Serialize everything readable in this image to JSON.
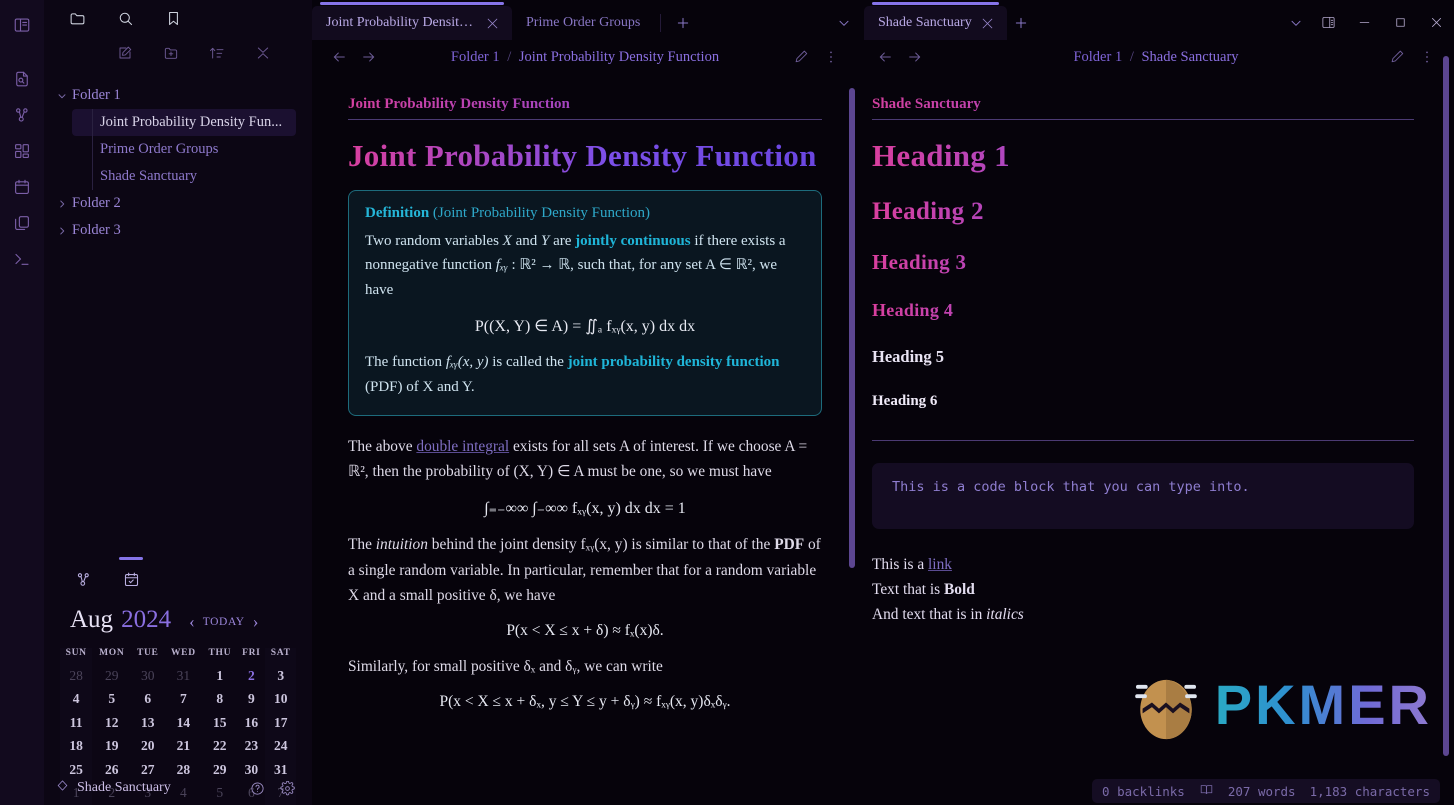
{
  "rail": {
    "icons": [
      {
        "name": "sidebar-toggle-icon",
        "label": "Toggle sidebar"
      },
      {
        "name": "file-search-icon",
        "label": "Search in file"
      },
      {
        "name": "graph-view-icon",
        "label": "Graph view"
      },
      {
        "name": "bases-grid-icon",
        "label": "Bases"
      },
      {
        "name": "calendar-icon",
        "label": "Calendar"
      },
      {
        "name": "templates-copy-icon",
        "label": "Templates"
      },
      {
        "name": "terminal-icon",
        "label": "Terminal"
      }
    ]
  },
  "sidebar": {
    "tabs": [
      {
        "name": "files-tab",
        "label": "Files"
      },
      {
        "name": "search-tab",
        "label": "Search"
      },
      {
        "name": "bookmarks-tab",
        "label": "Bookmarks"
      }
    ],
    "toolbar": [
      {
        "name": "new-note-button",
        "label": "New note"
      },
      {
        "name": "new-folder-button",
        "label": "New folder"
      },
      {
        "name": "sort-order-button",
        "label": "Change sort order"
      },
      {
        "name": "collapse-all-button",
        "label": "Collapse all"
      }
    ],
    "tree": [
      {
        "type": "folder",
        "label": "Folder 1",
        "expanded": true
      },
      {
        "type": "file",
        "label": "Joint Probability Density Fun...",
        "selected": true
      },
      {
        "type": "file",
        "label": "Prime Order Groups",
        "selected": false
      },
      {
        "type": "file",
        "label": "Shade Sanctuary",
        "selected": false
      },
      {
        "type": "folder",
        "label": "Folder 2",
        "expanded": false
      },
      {
        "type": "folder",
        "label": "Folder 3",
        "expanded": false
      }
    ],
    "calendar": {
      "tabs": [
        {
          "name": "outgoing-links-tab",
          "label": "Outgoing links"
        },
        {
          "name": "calendar-tab",
          "label": "Calendar"
        }
      ],
      "month": "Aug",
      "year": "2024",
      "today_label": "TODAY",
      "prev_label": "‹",
      "next_label": "›",
      "weekdays": [
        "SUN",
        "MON",
        "TUE",
        "WED",
        "THU",
        "FRI",
        "SAT"
      ],
      "weeks": [
        [
          {
            "d": "28",
            "dim": true
          },
          {
            "d": "29",
            "dim": true
          },
          {
            "d": "30",
            "dim": true
          },
          {
            "d": "31",
            "dim": true
          },
          {
            "d": "1"
          },
          {
            "d": "2",
            "hl": true
          },
          {
            "d": "3"
          }
        ],
        [
          {
            "d": "4"
          },
          {
            "d": "5"
          },
          {
            "d": "6"
          },
          {
            "d": "7"
          },
          {
            "d": "8"
          },
          {
            "d": "9"
          },
          {
            "d": "10"
          }
        ],
        [
          {
            "d": "11"
          },
          {
            "d": "12"
          },
          {
            "d": "13"
          },
          {
            "d": "14"
          },
          {
            "d": "15"
          },
          {
            "d": "16"
          },
          {
            "d": "17"
          }
        ],
        [
          {
            "d": "18"
          },
          {
            "d": "19"
          },
          {
            "d": "20"
          },
          {
            "d": "21"
          },
          {
            "d": "22"
          },
          {
            "d": "23"
          },
          {
            "d": "24"
          }
        ],
        [
          {
            "d": "25"
          },
          {
            "d": "26"
          },
          {
            "d": "27"
          },
          {
            "d": "28"
          },
          {
            "d": "29"
          },
          {
            "d": "30"
          },
          {
            "d": "31"
          }
        ],
        [
          {
            "d": "1",
            "dim": true
          },
          {
            "d": "2",
            "dim": true
          },
          {
            "d": "3",
            "dim": true
          },
          {
            "d": "4",
            "dim": true
          },
          {
            "d": "5",
            "dim": true
          },
          {
            "d": "6",
            "dim": true
          },
          {
            "d": "7",
            "dim": true
          }
        ]
      ]
    },
    "status": {
      "vault_name": "Shade Sanctuary",
      "help_label": "Help",
      "settings_label": "Settings"
    }
  },
  "left_pane": {
    "tabs": [
      {
        "label": "Joint Probability Density ...",
        "active": true
      },
      {
        "label": "Prime Order Groups",
        "active": false
      }
    ],
    "new_tab_label": "+",
    "tab_list_label": "⌄",
    "breadcrumb": {
      "folder": "Folder 1",
      "separator": "/",
      "current": "Joint Probability Density Function"
    },
    "edit_label": "Edit",
    "more_label": "More options",
    "back_label": "Back",
    "forward_label": "Forward",
    "doc": {
      "inline_title": "Joint Probability Density Function",
      "h1": "Joint Probability Density Function",
      "callout": {
        "head_bold": "Definition",
        "head_rest": "(Joint Probability Density Function)",
        "p1_a": "Two random variables ",
        "p1_x": "X",
        "p1_b": " and ",
        "p1_y": "Y",
        "p1_c": " are ",
        "p1_link": "jointly continuous",
        "p1_d": " if there exists a nonnegative function ",
        "p1_f": "fₓᵧ",
        "p1_e": " : ℝ² → ℝ, such that, for any set A ∈ ℝ², we have",
        "math": "P((X, Y) ∈ A) = ∬ₐ fₓᵧ(x, y) dx dx",
        "p2_a": "The function ",
        "p2_f": "fₓᵧ(x, y)",
        "p2_b": " is called the ",
        "p2_link": "joint probability density function",
        "p2_c": " (PDF) of X and Y."
      },
      "p_after_a": "The above ",
      "p_after_link": "double integral",
      "p_after_b": " exists for all sets A of interest. If we choose A = ℝ², then the probability of (X, Y) ∈ A must be one, so we must have",
      "math2": "∫₌₋∞∞ ∫₋∞∞ fₓᵧ(x, y) dx dx = 1",
      "p_intuition_a": "The ",
      "p_intuition_em": "intuition",
      "p_intuition_b": " behind the joint density fₓᵧ(x, y) is similar to that of the ",
      "p_intuition_bold": "PDF",
      "p_intuition_c": " of a single random variable. In particular, remember that for a random variable X and a small positive δ, we have",
      "math3": "P(x < X ≤ x + δ) ≈ fₓ(x)δ.",
      "p_similarly": "Similarly, for small positive δₓ and δᵧ, we can write",
      "math4": "P(x < X ≤ x + δₓ, y ≤ Y ≤ y + δᵧ) ≈ fₓᵧ(x, y)δₓδᵧ."
    }
  },
  "right_pane": {
    "tabs": [
      {
        "label": "Shade Sanctuary",
        "active": true
      }
    ],
    "new_tab_label": "+",
    "tab_list_label": "⌄",
    "breadcrumb": {
      "folder": "Folder 1",
      "separator": "/",
      "current": "Shade Sanctuary"
    },
    "edit_label": "Edit",
    "more_label": "More options",
    "back_label": "Back",
    "forward_label": "Forward",
    "window": {
      "right_sidebar_label": "Toggle right sidebar",
      "minimize_label": "Minimize",
      "maximize_label": "Maximize",
      "close_label": "Close"
    },
    "doc": {
      "inline_title": "Shade Sanctuary",
      "h1": "Heading 1",
      "h2": "Heading 2",
      "h3": "Heading 3",
      "h4": "Heading 4",
      "h5": "Heading 5",
      "h6": "Heading 6",
      "code": "This is a code block that you can type into.",
      "line1_a": "This is a ",
      "line1_link": "link",
      "line2_a": "Text that is ",
      "line2_b": "Bold",
      "line3_a": "And text that is in ",
      "line3_b": "italics"
    },
    "watermark": {
      "word": "PKMER"
    },
    "status": {
      "backlinks": "0 backlinks",
      "words": "207 words",
      "characters": "1,183 characters",
      "reading_icon": "book-open-icon"
    }
  },
  "colors": {
    "accent": "#8674e8",
    "heading_gradient_from": "#d93f9e",
    "heading_gradient_to": "#6a46e0",
    "callout_border": "#1d6b7c",
    "callout_text": "#25b6d8",
    "background": "#06030b"
  }
}
